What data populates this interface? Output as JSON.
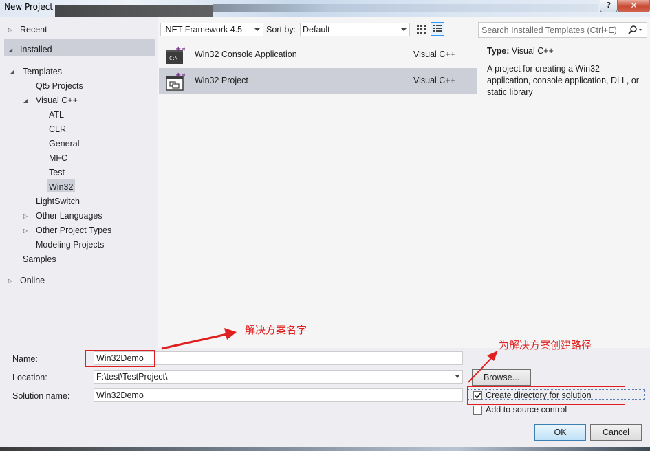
{
  "window": {
    "title": "New Project",
    "help_label": "?",
    "close_label": "✕"
  },
  "tree": {
    "items": [
      {
        "label": "Recent",
        "arrow": "▷"
      },
      {
        "label": "Installed",
        "arrow": "◢"
      },
      {
        "label": "Templates",
        "arrow": "◢"
      },
      {
        "label": "Qt5 Projects",
        "arrow": ""
      },
      {
        "label": "Visual C++",
        "arrow": "◢"
      },
      {
        "label": "ATL",
        "arrow": ""
      },
      {
        "label": "CLR",
        "arrow": ""
      },
      {
        "label": "General",
        "arrow": ""
      },
      {
        "label": "MFC",
        "arrow": ""
      },
      {
        "label": "Test",
        "arrow": ""
      },
      {
        "label": "Win32",
        "arrow": ""
      },
      {
        "label": "LightSwitch",
        "arrow": ""
      },
      {
        "label": "Other Languages",
        "arrow": "▷"
      },
      {
        "label": "Other Project Types",
        "arrow": "▷"
      },
      {
        "label": "Modeling Projects",
        "arrow": ""
      },
      {
        "label": "Samples",
        "arrow": ""
      },
      {
        "label": "Online",
        "arrow": "▷"
      }
    ]
  },
  "toolbar": {
    "framework": ".NET Framework 4.5",
    "sort_label": "Sort by:",
    "sort_value": "Default"
  },
  "templates": [
    {
      "name": "Win32 Console Application",
      "lang": "Visual C++"
    },
    {
      "name": "Win32 Project",
      "lang": "Visual C++"
    }
  ],
  "search": {
    "placeholder": "Search Installed Templates (Ctrl+E)"
  },
  "details": {
    "type_label": "Type:",
    "type_value": "Visual C++",
    "description": "A project for creating a Win32 application, console application, DLL, or static library"
  },
  "form": {
    "name_label": "Name:",
    "name_value": "Win32Demo",
    "location_label": "Location:",
    "location_value": "F:\\test\\TestProject\\",
    "solution_label": "Solution name:",
    "solution_value": "Win32Demo",
    "browse_label": "Browse...",
    "create_dir_label": "Create directory for solution",
    "create_dir_checked": true,
    "source_control_label": "Add to source control",
    "source_control_checked": false,
    "ok_label": "OK",
    "cancel_label": "Cancel"
  },
  "annotations": {
    "name_note": "解决方案名字",
    "path_note": "为解决方案创建路径",
    "color": "#e02020"
  }
}
